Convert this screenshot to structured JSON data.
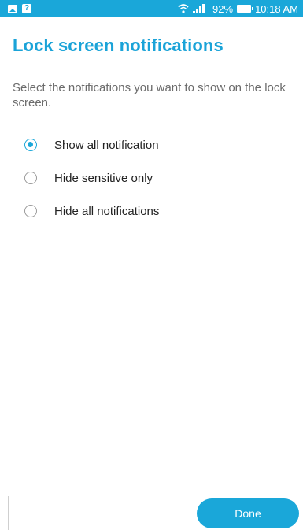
{
  "status_bar": {
    "battery": "92%",
    "time": "10:18 AM",
    "left_icons": [
      "image-icon",
      "question-icon"
    ],
    "right_icons": [
      "wifi-icon",
      "signal-icon",
      "battery-icon"
    ],
    "background_color": "#1aa7d9"
  },
  "page": {
    "title": "Lock screen notifications",
    "description": "Select the notifications you want to show on the lock screen."
  },
  "options": [
    {
      "label": "Show all notification",
      "selected": true
    },
    {
      "label": "Hide sensitive only",
      "selected": false
    },
    {
      "label": "Hide all notifications",
      "selected": false
    }
  ],
  "actions": {
    "done_label": "Done"
  },
  "colors": {
    "accent": "#1aa7d9",
    "title": "#1aa3d8",
    "text": "#222222",
    "secondary_text": "#6b6b6b"
  }
}
